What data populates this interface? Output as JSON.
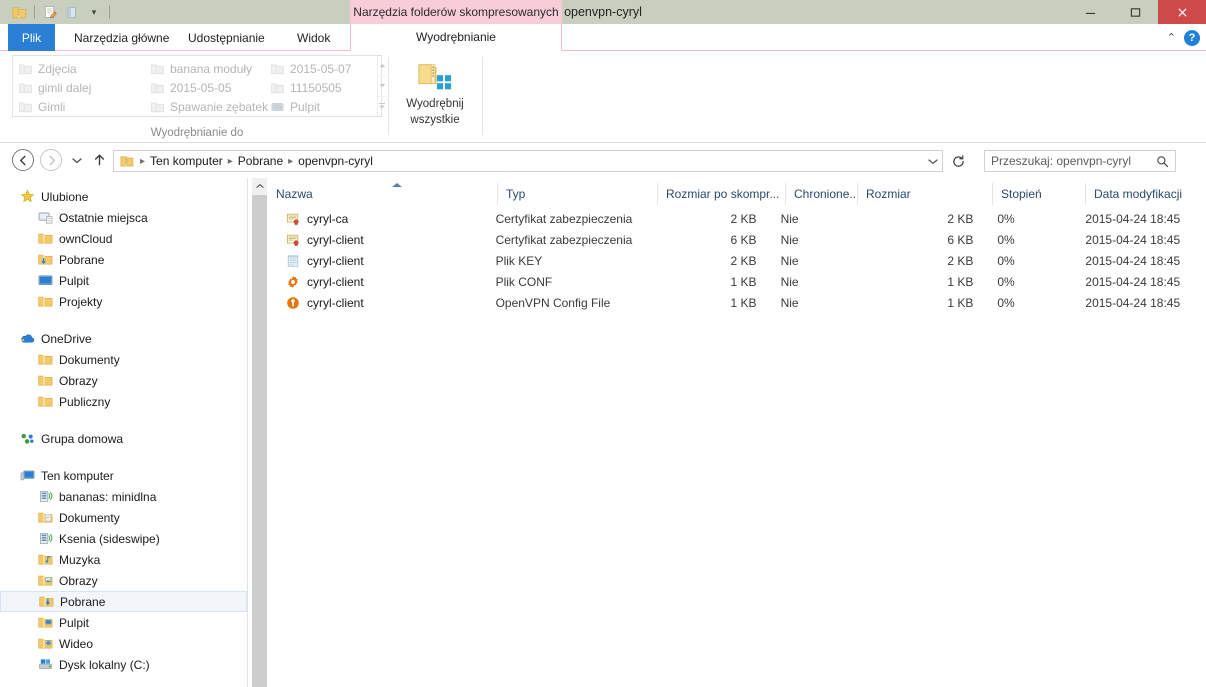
{
  "window": {
    "title": "openvpn-cyryl",
    "contextual_tab_group": "Narzędzia folderów skompresowanych",
    "minimize": "–",
    "maximize": "□",
    "close": "✕"
  },
  "quick_access": {
    "items": [
      {
        "name": "zip-folder-icon",
        "label": ""
      },
      {
        "name": "properties-icon",
        "label": ""
      },
      {
        "name": "new-folder-icon",
        "label": ""
      },
      {
        "name": "customize-qat-chevron-icon",
        "label": "▾"
      }
    ]
  },
  "tabs": {
    "file": "Plik",
    "items": [
      "Narzędzia główne",
      "Udostępnianie",
      "Widok"
    ],
    "contextual": "Wyodrębnianie",
    "collapse_ribbon": "⌃",
    "help": "?"
  },
  "ribbon": {
    "groups": [
      {
        "label": "Wyodrębnianie do",
        "gallery": {
          "column1": [
            "Zdjęcia",
            "gimli dalej",
            "Gimli"
          ],
          "column2": [
            "banana moduły",
            "2015-05-05",
            "Spawanie zębatek"
          ],
          "column3": [
            "2015-05-07",
            "11150505",
            "Pulpit"
          ],
          "scroll_up": "▲",
          "scroll_down": "▼",
          "more": "▼"
        }
      },
      {
        "label": "",
        "button": {
          "line1": "Wyodrębnij",
          "line2": "wszystkie"
        }
      }
    ]
  },
  "address_bar": {
    "back": "←",
    "forward": "→",
    "recent_dropdown": "▾",
    "up": "↑",
    "breadcrumb": [
      "Ten komputer",
      "Pobrane",
      "openvpn-cyryl"
    ],
    "breadcrumb_separator": "▸",
    "path_dropdown": "⌄",
    "refresh": "↻",
    "search_placeholder": "Przeszukaj: openvpn-cyryl",
    "search_value": "",
    "search_icon": "⌕"
  },
  "nav_pane": {
    "scroll_up": "⌃",
    "sections": [
      {
        "name": "favorites",
        "root": {
          "label": "Ulubione",
          "icon": "star-icon"
        },
        "children": [
          {
            "label": "Ostatnie miejsca",
            "icon": "recent-places-icon"
          },
          {
            "label": "ownCloud",
            "icon": "folder-icon"
          },
          {
            "label": "Pobrane",
            "icon": "downloads-folder-icon"
          },
          {
            "label": "Pulpit",
            "icon": "desktop-icon"
          },
          {
            "label": "Projekty",
            "icon": "folder-icon"
          }
        ]
      },
      {
        "name": "onedrive",
        "root": {
          "label": "OneDrive",
          "icon": "onedrive-cloud-icon"
        },
        "children": [
          {
            "label": "Dokumenty",
            "icon": "folder-icon"
          },
          {
            "label": "Obrazy",
            "icon": "folder-icon"
          },
          {
            "label": "Publiczny",
            "icon": "folder-icon"
          }
        ]
      },
      {
        "name": "homegroup",
        "root": {
          "label": "Grupa domowa",
          "icon": "homegroup-icon"
        },
        "children": []
      },
      {
        "name": "this-pc",
        "root": {
          "label": "Ten komputer",
          "icon": "computer-icon"
        },
        "children": [
          {
            "label": "bananas: minidlna",
            "icon": "media-server-icon",
            "selected": false
          },
          {
            "label": "Dokumenty",
            "icon": "documents-folder-icon",
            "selected": false
          },
          {
            "label": "Ksenia (sideswipe)",
            "icon": "media-server-icon",
            "selected": false
          },
          {
            "label": "Muzyka",
            "icon": "music-folder-icon",
            "selected": false
          },
          {
            "label": "Obrazy",
            "icon": "pictures-folder-icon",
            "selected": false
          },
          {
            "label": "Pobrane",
            "icon": "downloads-folder-icon",
            "selected": true
          },
          {
            "label": "Pulpit",
            "icon": "desktop-folder-icon",
            "selected": false
          },
          {
            "label": "Wideo",
            "icon": "videos-folder-icon",
            "selected": false
          },
          {
            "label": "Dysk lokalny (C:)",
            "icon": "local-disk-icon",
            "selected": false
          }
        ]
      }
    ]
  },
  "file_list": {
    "columns": [
      {
        "key": "name",
        "label": "Nazwa",
        "sorted": "asc"
      },
      {
        "key": "type",
        "label": "Typ"
      },
      {
        "key": "packed_size",
        "label": "Rozmiar po skompr..."
      },
      {
        "key": "protected",
        "label": "Chronione..."
      },
      {
        "key": "size",
        "label": "Rozmiar"
      },
      {
        "key": "ratio",
        "label": "Stopień"
      },
      {
        "key": "modified",
        "label": "Data modyfikacji"
      }
    ],
    "rows": [
      {
        "icon": "certificate-icon",
        "name": "cyryl-ca",
        "type": "Certyfikat zabezpieczenia",
        "packed_size": "2 KB",
        "protected": "Nie",
        "size": "2 KB",
        "ratio": "0%",
        "modified": "2015-04-24 18:45"
      },
      {
        "icon": "certificate-icon",
        "name": "cyryl-client",
        "type": "Certyfikat zabezpieczenia",
        "packed_size": "6 KB",
        "protected": "Nie",
        "size": "6 KB",
        "ratio": "0%",
        "modified": "2015-04-24 18:45"
      },
      {
        "icon": "notepad-key-icon",
        "name": "cyryl-client",
        "type": "Plik KEY",
        "packed_size": "2 KB",
        "protected": "Nie",
        "size": "2 KB",
        "ratio": "0%",
        "modified": "2015-04-24 18:45"
      },
      {
        "icon": "gear-conf-icon",
        "name": "cyryl-client",
        "type": "Plik CONF",
        "packed_size": "1 KB",
        "protected": "Nie",
        "size": "1 KB",
        "ratio": "0%",
        "modified": "2015-04-24 18:45"
      },
      {
        "icon": "openvpn-icon",
        "name": "cyryl-client",
        "type": "OpenVPN Config File",
        "packed_size": "1 KB",
        "protected": "Nie",
        "size": "1 KB",
        "ratio": "0%",
        "modified": "2015-04-24 18:45"
      }
    ]
  },
  "colors": {
    "titlebar": "#c9cfbe",
    "contextual_tab": "#f8ccd9",
    "file_tab": "#2a7fd4",
    "close_button": "#cf4a4a",
    "column_header_text": "#2a4a6b",
    "selection": "#f2f6fb"
  }
}
